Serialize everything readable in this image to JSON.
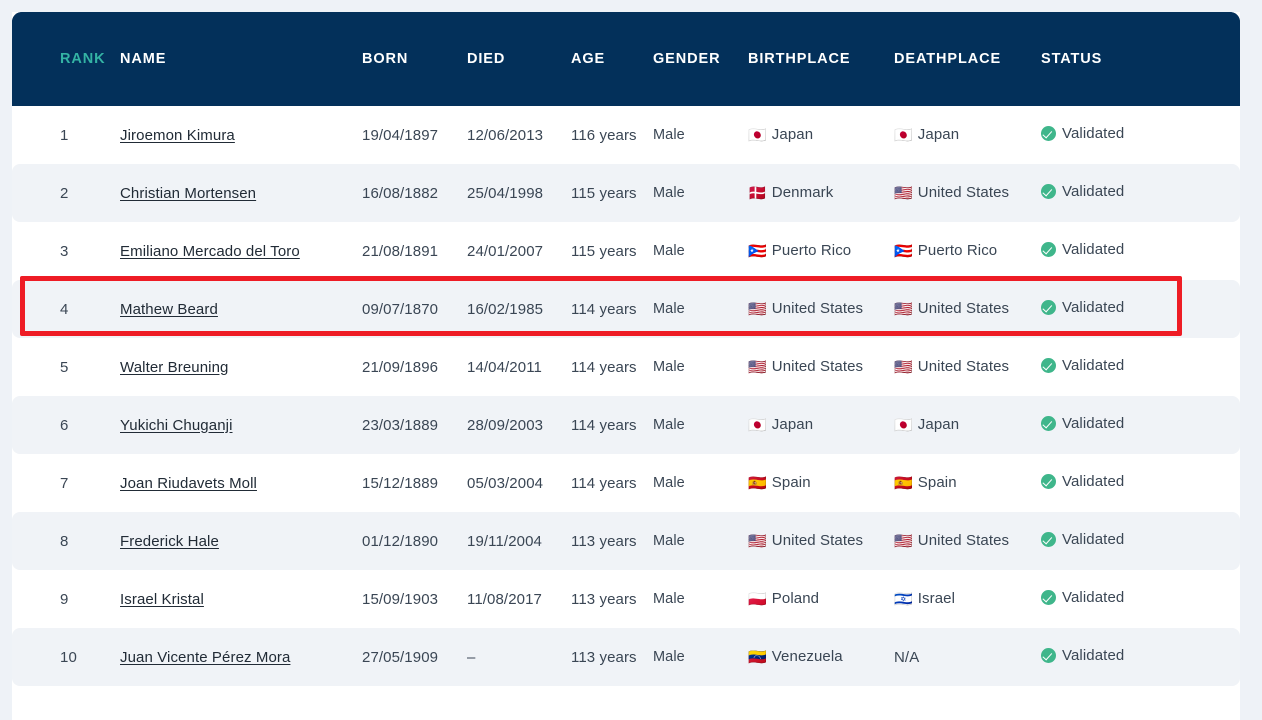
{
  "table": {
    "columns": [
      {
        "key": "rank",
        "label": "RANK"
      },
      {
        "key": "name",
        "label": "NAME"
      },
      {
        "key": "born",
        "label": "BORN"
      },
      {
        "key": "died",
        "label": "DIED"
      },
      {
        "key": "age",
        "label": "AGE"
      },
      {
        "key": "gender",
        "label": "GENDER"
      },
      {
        "key": "birthplace",
        "label": "BIRTHPLACE"
      },
      {
        "key": "deathplace",
        "label": "DEATHPLACE"
      },
      {
        "key": "status",
        "label": "STATUS"
      }
    ],
    "rows": [
      {
        "rank": "1",
        "name": "Jiroemon Kimura",
        "born": "19/04/1897",
        "died": "12/06/2013",
        "age": "116 years",
        "gender": "Male",
        "birthplace": "Japan",
        "birthplace_flag": "🇯🇵",
        "deathplace": "Japan",
        "deathplace_flag": "🇯🇵",
        "status": "Validated"
      },
      {
        "rank": "2",
        "name": "Christian Mortensen",
        "born": "16/08/1882",
        "died": "25/04/1998",
        "age": "115 years",
        "gender": "Male",
        "birthplace": "Denmark",
        "birthplace_flag": "🇩🇰",
        "deathplace": "United States",
        "deathplace_flag": "🇺🇸",
        "status": "Validated"
      },
      {
        "rank": "3",
        "name": "Emiliano Mercado del Toro",
        "born": "21/08/1891",
        "died": "24/01/2007",
        "age": "115 years",
        "gender": "Male",
        "birthplace": "Puerto Rico",
        "birthplace_flag": "🇵🇷",
        "deathplace": "Puerto Rico",
        "deathplace_flag": "🇵🇷",
        "status": "Validated"
      },
      {
        "rank": "4",
        "name": "Mathew Beard",
        "born": "09/07/1870",
        "died": "16/02/1985",
        "age": "114 years",
        "gender": "Male",
        "birthplace": "United States",
        "birthplace_flag": "🇺🇸",
        "deathplace": "United States",
        "deathplace_flag": "🇺🇸",
        "status": "Validated"
      },
      {
        "rank": "5",
        "name": "Walter Breuning",
        "born": "21/09/1896",
        "died": "14/04/2011",
        "age": "114 years",
        "gender": "Male",
        "birthplace": "United States",
        "birthplace_flag": "🇺🇸",
        "deathplace": "United States",
        "deathplace_flag": "🇺🇸",
        "status": "Validated"
      },
      {
        "rank": "6",
        "name": "Yukichi Chuganji",
        "born": "23/03/1889",
        "died": "28/09/2003",
        "age": "114 years",
        "gender": "Male",
        "birthplace": "Japan",
        "birthplace_flag": "🇯🇵",
        "deathplace": "Japan",
        "deathplace_flag": "🇯🇵",
        "status": "Validated"
      },
      {
        "rank": "7",
        "name": "Joan Riudavets Moll",
        "born": "15/12/1889",
        "died": "05/03/2004",
        "age": "114 years",
        "gender": "Male",
        "birthplace": "Spain",
        "birthplace_flag": "🇪🇸",
        "deathplace": "Spain",
        "deathplace_flag": "🇪🇸",
        "status": "Validated"
      },
      {
        "rank": "8",
        "name": "Frederick Hale",
        "born": "01/12/1890",
        "died": "19/11/2004",
        "age": "113 years",
        "gender": "Male",
        "birthplace": "United States",
        "birthplace_flag": "🇺🇸",
        "deathplace": "United States",
        "deathplace_flag": "🇺🇸",
        "status": "Validated"
      },
      {
        "rank": "9",
        "name": "Israel Kristal",
        "born": "15/09/1903",
        "died": "11/08/2017",
        "age": "113 years",
        "gender": "Male",
        "birthplace": "Poland",
        "birthplace_flag": "🇵🇱",
        "deathplace": "Israel",
        "deathplace_flag": "🇮🇱",
        "status": "Validated"
      },
      {
        "rank": "10",
        "name": "Juan Vicente Pérez Mora",
        "born": "27/05/1909",
        "died": "–",
        "age": "113 years",
        "gender": "Male",
        "birthplace": "Venezuela",
        "birthplace_flag": "🇻🇪",
        "deathplace": "N/A",
        "deathplace_flag": "",
        "status": "Validated"
      }
    ]
  },
  "annotation": {
    "highlighted_rank": "4",
    "box_color": "#ee1c25"
  },
  "theme": {
    "header_bg": "#03305a",
    "rank_header_color": "#34b3a4",
    "row_alt_bg": "#f0f3f7",
    "page_bg": "#eef2f7",
    "status_badge_color": "#3fb68b"
  }
}
